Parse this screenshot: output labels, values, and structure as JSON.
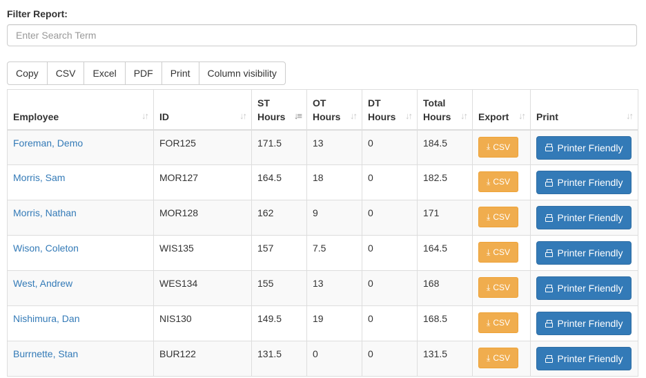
{
  "filter": {
    "label": "Filter Report:",
    "placeholder": "Enter Search Term",
    "value": ""
  },
  "toolbar": {
    "buttons": [
      "Copy",
      "CSV",
      "Excel",
      "PDF",
      "Print",
      "Column visibility"
    ]
  },
  "table": {
    "columns": [
      {
        "line1": "Employee",
        "line2": ""
      },
      {
        "line1": "ID",
        "line2": ""
      },
      {
        "line1": "ST",
        "line2": "Hours"
      },
      {
        "line1": "OT",
        "line2": "Hours"
      },
      {
        "line1": "DT",
        "line2": "Hours"
      },
      {
        "line1": "Total",
        "line2": "Hours"
      },
      {
        "line1": "Export",
        "line2": ""
      },
      {
        "line1": "Print",
        "line2": ""
      }
    ],
    "sorted_column": "ST Hours",
    "sort_direction": "descending",
    "rows": [
      {
        "employee": "Foreman, Demo",
        "id": "FOR125",
        "st": "171.5",
        "ot": "13",
        "dt": "0",
        "total": "184.5"
      },
      {
        "employee": "Morris, Sam",
        "id": "MOR127",
        "st": "164.5",
        "ot": "18",
        "dt": "0",
        "total": "182.5"
      },
      {
        "employee": "Morris, Nathan",
        "id": "MOR128",
        "st": "162",
        "ot": "9",
        "dt": "0",
        "total": "171"
      },
      {
        "employee": "Wison, Coleton",
        "id": "WIS135",
        "st": "157",
        "ot": "7.5",
        "dt": "0",
        "total": "164.5"
      },
      {
        "employee": "West, Andrew",
        "id": "WES134",
        "st": "155",
        "ot": "13",
        "dt": "0",
        "total": "168"
      },
      {
        "employee": "Nishimura, Dan",
        "id": "NIS130",
        "st": "149.5",
        "ot": "19",
        "dt": "0",
        "total": "168.5"
      },
      {
        "employee": "Burrnette, Stan",
        "id": "BUR122",
        "st": "131.5",
        "ot": "0",
        "dt": "0",
        "total": "131.5"
      }
    ],
    "export_label": "CSV",
    "print_label": "Printer Friendly"
  },
  "icons": {
    "sort": "sort-both-icon",
    "sort_active": "sort-amount-desc-icon",
    "download": "download-icon",
    "print": "print-icon"
  },
  "colors": {
    "link": "#337ab7",
    "csv_button": "#f0ad4e",
    "print_button": "#337ab7",
    "stripe": "#f9f9f9"
  }
}
